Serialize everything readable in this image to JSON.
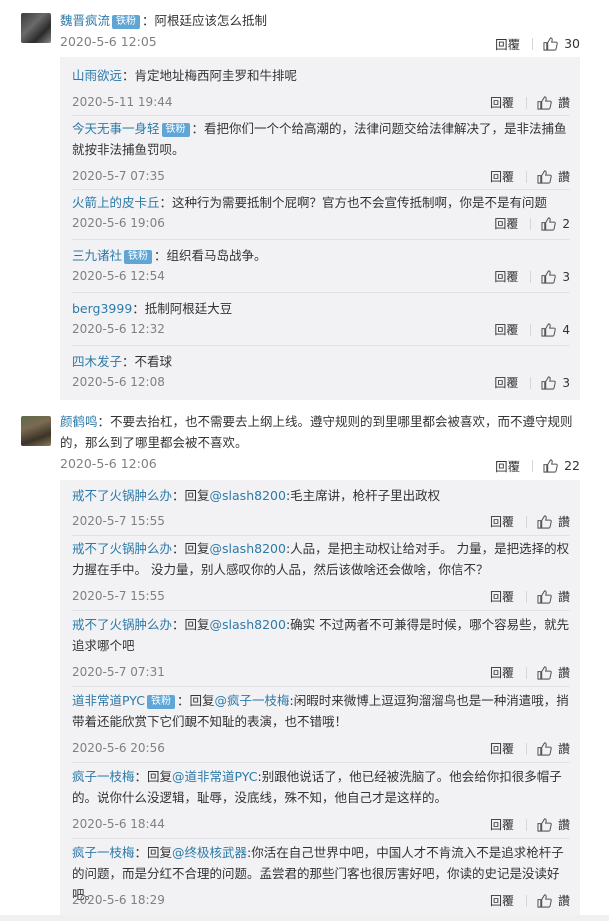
{
  "comments": [
    {
      "author": "魏晋疯流",
      "badge": "铁粉",
      "text": "：阿根廷应该怎么抵制",
      "time": "2020-5-6 12:05",
      "reply_label": "回覆",
      "likes": "30",
      "subs": [
        {
          "author": "山雨欲远",
          "badge": "",
          "text": "：肯定地址梅西阿圭罗和牛排呢",
          "time": "2020-5-11 19:44",
          "reply_label": "回覆",
          "likes": "讚"
        },
        {
          "author": "今天无事一身轻",
          "badge": "铁粉",
          "text": "：看把你们一个个给高潮的，法律问题交给法律解决了，是非法捕鱼就按非法捕鱼罚呗。",
          "time": "2020-5-7 07:35",
          "reply_label": "回覆",
          "likes": "讚"
        },
        {
          "author": "火箭上的皮卡丘",
          "badge": "",
          "text": "：这种行为需要抵制个屁啊？官方也不会宣传抵制啊，你是不是有问题",
          "time": "2020-5-6 19:06",
          "reply_label": "回覆",
          "likes": "2"
        },
        {
          "author": "三九诸社",
          "badge": "铁粉",
          "text": "：组织看马岛战争。",
          "time": "2020-5-6 12:54",
          "reply_label": "回覆",
          "likes": "3"
        },
        {
          "author": "berg3999",
          "badge": "",
          "text": "：抵制阿根廷大豆",
          "time": "2020-5-6 12:32",
          "reply_label": "回覆",
          "likes": "4"
        },
        {
          "author": "四木发子",
          "badge": "",
          "text": "：不看球",
          "time": "2020-5-6 12:08",
          "reply_label": "回覆",
          "likes": "3"
        }
      ]
    },
    {
      "author": "颜鹤鸣",
      "badge": "",
      "text": "：不要去抬杠，也不需要去上纲上线。遵守规则的到里哪里都会被喜欢，而不遵守规则的，那么到了哪里都会被不喜欢。",
      "time": "2020-5-6 12:06",
      "reply_label": "回覆",
      "likes": "22",
      "subs": [
        {
          "author": "戒不了火锅肿么办",
          "badge": "",
          "prefix": "：回复",
          "mention": "@slash8200",
          "text": ":毛主席讲，枪杆子里出政权",
          "time": "2020-5-7 15:55",
          "reply_label": "回覆",
          "likes": "讚"
        },
        {
          "author": "戒不了火锅肿么办",
          "badge": "",
          "prefix": "：回复",
          "mention": "@slash8200",
          "text": ":人品，是把主动权让给对手。 力量，是把选择的权力握在手中。 没力量，别人感叹你的人品，然后该做啥还会做啥，你信不？",
          "time": "2020-5-7 15:55",
          "reply_label": "回覆",
          "likes": "讚"
        },
        {
          "author": "戒不了火锅肿么办",
          "badge": "",
          "prefix": "：回复",
          "mention": "@slash8200",
          "text": ":确实 不过两者不可兼得是时候，哪个容易些，就先追求哪个吧",
          "time": "2020-5-7 07:31",
          "reply_label": "回覆",
          "likes": "讚"
        },
        {
          "author": "道非常道PYC",
          "badge": "铁粉",
          "prefix": "：回复",
          "mention": "@疯子一枝梅",
          "text": ":闲暇时来微博上逗逗狗溜溜鸟也是一种消遣哦，捎带着还能欣赏下它们靦不知耻的表演，也不错哦！",
          "time": "2020-5-6 20:56",
          "reply_label": "回覆",
          "likes": "讚"
        },
        {
          "author": "疯子一枝梅",
          "badge": "",
          "prefix": "：回复",
          "mention": "@道非常道PYC",
          "text": ":别跟他说话了，他已经被洗脑了。他会给你扣很多帽子的。说你什么没逻辑，耻辱，没底线，殊不知，他自己才是这样的。",
          "time": "2020-5-6 18:44",
          "reply_label": "回覆",
          "likes": "讚"
        },
        {
          "author": "疯子一枝梅",
          "badge": "",
          "prefix": "：回复",
          "mention": "@终极核武器",
          "text": ":你活在自己世界中吧，中国人才不肯流入不是追求枪杆子的问题，而是分红不合理的问题。孟尝君的那些门客也很厉害好吧，你读的史记是没读好吧。",
          "time": "2020-5-6 18:29",
          "reply_label": "回覆",
          "likes": "讚"
        }
      ]
    }
  ],
  "colors": {
    "link": "#2d7aa8",
    "badge_bg": "#5fa6d6",
    "sub_bg": "#f2f2f5",
    "meta": "#808080"
  },
  "icons": {
    "avatar": "avatar",
    "like": "thumbs-up-icon"
  }
}
